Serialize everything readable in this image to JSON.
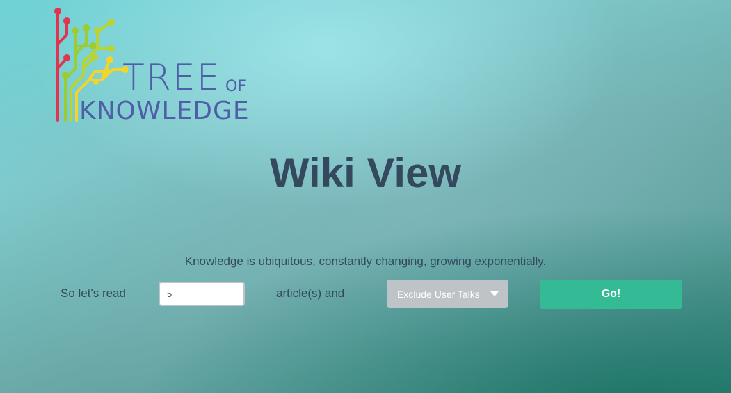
{
  "logo": {
    "word_tree": "TREE",
    "word_of": "OF",
    "word_knowledge": "KNOWLEDGE",
    "colors": {
      "red": "#e0344f",
      "light_green": "#9ccc2e",
      "green": "#b9d431",
      "yellow": "#f2d42a",
      "text": "#4f5ea6"
    }
  },
  "page": {
    "title": "Wiki View",
    "tagline": "Knowledge is ubiquitous, constantly changing, growing exponentially."
  },
  "form": {
    "read_label": "So let's read",
    "count_value": "5",
    "articles_label": "article(s) and",
    "filter_selected": "Exclude User Talks",
    "go_label": "Go!"
  },
  "colors": {
    "title_text": "#34495e",
    "button_go": "#34bb96",
    "dropdown_bg": "#bdc3c7"
  }
}
